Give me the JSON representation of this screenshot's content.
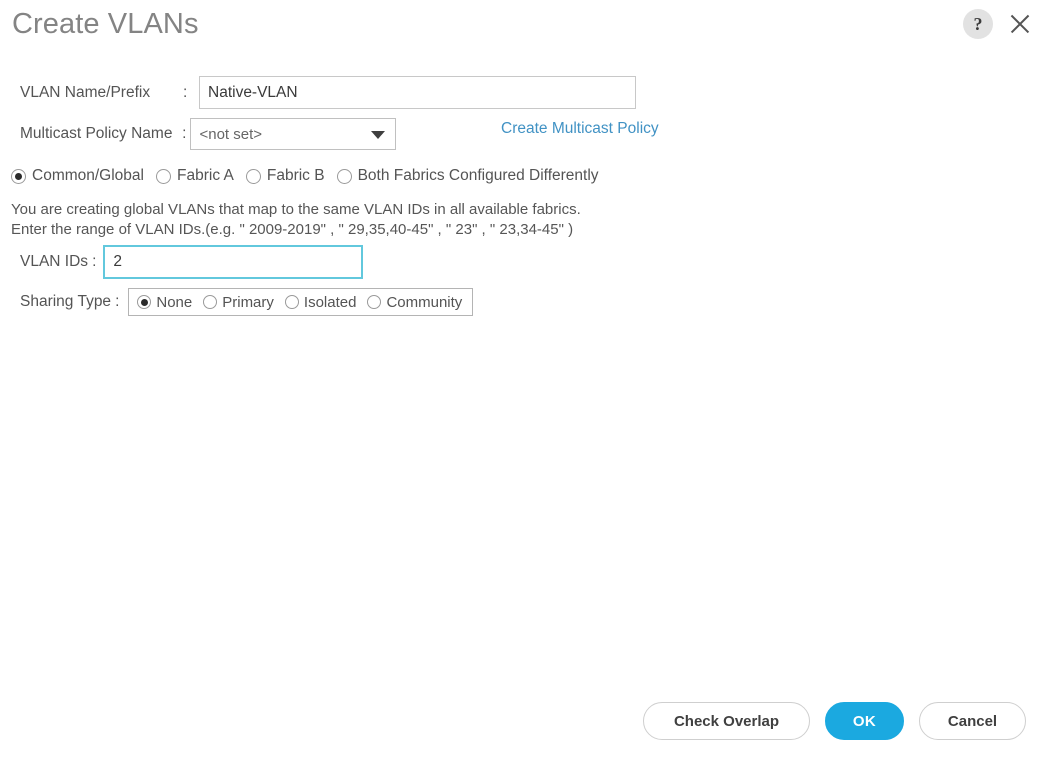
{
  "header": {
    "title": "Create VLANs",
    "help_icon": "question-mark-icon",
    "help_glyph": "?",
    "close_icon": "close-icon"
  },
  "form": {
    "vlan_name": {
      "label": "VLAN Name/Prefix",
      "colon": ":",
      "value": "Native-VLAN",
      "placeholder": ""
    },
    "multicast_policy": {
      "label": "Multicast Policy Name",
      "colon": ":",
      "value": "<not set>",
      "options": [
        "<not set>"
      ],
      "caret_icon": "chevron-down-icon"
    },
    "create_multicast_policy_link": "Create Multicast Policy",
    "fabric_scope": {
      "selected": "Common/Global",
      "options": [
        {
          "label": "Common/Global",
          "selected": true
        },
        {
          "label": "Fabric A",
          "selected": false
        },
        {
          "label": "Fabric B",
          "selected": false
        },
        {
          "label": "Both Fabrics Configured Differently",
          "selected": false
        }
      ]
    },
    "description": {
      "line1": "You are creating global VLANs that map to the same VLAN IDs in all available fabrics.",
      "line2": "Enter the range of VLAN IDs.(e.g. \" 2009-2019\" , \" 29,35,40-45\" , \" 23\" , \" 23,34-45\" )"
    },
    "vlan_ids": {
      "label": "VLAN IDs",
      "colon": ":",
      "value": "2",
      "placeholder": ""
    },
    "sharing_type": {
      "label": "Sharing Type",
      "colon": ":",
      "selected": "None",
      "options": [
        {
          "label": "None",
          "selected": true
        },
        {
          "label": "Primary",
          "selected": false
        },
        {
          "label": "Isolated",
          "selected": false
        },
        {
          "label": "Community",
          "selected": false
        }
      ]
    }
  },
  "footer": {
    "check_overlap_label": "Check Overlap",
    "ok_label": "OK",
    "cancel_label": "Cancel"
  },
  "colors": {
    "primary_button": "#1ba9e0",
    "link": "#4192c4",
    "focus_border": "#62c8dd",
    "title_text": "#848484",
    "body_text": "#545454",
    "input_border": "#c8c8c8"
  }
}
